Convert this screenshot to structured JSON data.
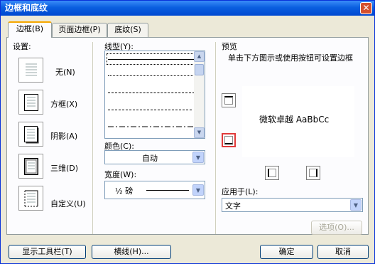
{
  "window": {
    "title": "边框和底纹",
    "close_glyph": "✕"
  },
  "tabs": [
    {
      "label": "边框(B)",
      "active": true
    },
    {
      "label": "页面边框(P)",
      "active": false
    },
    {
      "label": "底纹(S)",
      "active": false
    }
  ],
  "settings": {
    "heading": "设置:",
    "items": [
      {
        "label": "无(N)",
        "icon": "no-border-icon"
      },
      {
        "label": "方框(X)",
        "icon": "box-border-icon"
      },
      {
        "label": "阴影(A)",
        "icon": "shadow-border-icon"
      },
      {
        "label": "三维(D)",
        "icon": "3d-border-icon"
      },
      {
        "label": "自定义(U)",
        "icon": "custom-border-icon"
      }
    ]
  },
  "line_style": {
    "label": "线型(Y):",
    "options": [
      "solid",
      "dotted",
      "dashed-fine",
      "dashed",
      "dash-dot",
      "long-dash"
    ],
    "selected": "solid"
  },
  "color": {
    "label": "颜色(C):",
    "value": "自动"
  },
  "width": {
    "label": "宽度(W):",
    "value": "½ 磅"
  },
  "preview": {
    "heading": "预览",
    "instructions": "单击下方图示或使用按钮可设置边框",
    "sample_text": "微软卓越 AaBbCc"
  },
  "apply_to": {
    "label": "应用于(L):",
    "value": "文字"
  },
  "buttons": {
    "options": "选项(O)...",
    "show_toolbar": "显示工具栏(T)",
    "horizontal_line": "横线(H)...",
    "ok": "确定",
    "cancel": "取消"
  },
  "colors": {
    "title_bar": "#0a5fe0",
    "dialog_bg": "#ece9d8",
    "tab_highlight": "#f6a700",
    "selected_button_border": "#e03a3a"
  }
}
